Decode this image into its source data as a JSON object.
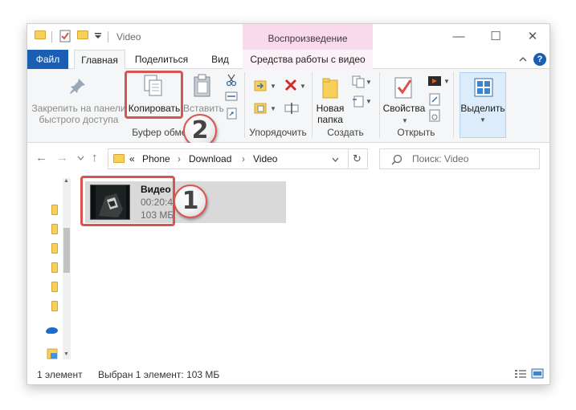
{
  "titlebar": {
    "title": "Video",
    "context_title": "Воспроизведение",
    "minimize": "—",
    "maximize": "☐",
    "close": "✕"
  },
  "tabs": {
    "file": "Файл",
    "home": "Главная",
    "share": "Поделиться",
    "view": "Вид",
    "video_tools": "Средства работы с видео"
  },
  "ribbon": {
    "pin": "Закрепить на панели быстрого доступа",
    "pin_line1": "Закрепить на панели",
    "pin_line2": "быстрого доступа",
    "copy": "Копировать",
    "paste": "Вставить",
    "clipboard_group": "Буфер обмена",
    "organize_group": "Упорядочить",
    "new_folder_line1": "Новая",
    "new_folder_line2": "папка",
    "create_group": "Создать",
    "properties": "Свойства",
    "open_group": "Открыть",
    "select": "Выделить"
  },
  "address": {
    "overflow": "«",
    "path": [
      "Phone",
      "Download",
      "Video"
    ],
    "sep": "›",
    "search_placeholder": "Поиск: Video"
  },
  "file": {
    "name": "Видео",
    "duration": "00:20:41",
    "size": "103 МБ"
  },
  "annotations": {
    "badge1": "1",
    "badge2": "2",
    "highlight_color": "#d9534f"
  },
  "status": {
    "count": "1 элемент",
    "selected": "Выбран 1 элемент: 103 МБ"
  },
  "colors": {
    "file_tab": "#1a5fb4",
    "context_tab": "#f9d9ec",
    "selection": "#d9d9d9"
  }
}
